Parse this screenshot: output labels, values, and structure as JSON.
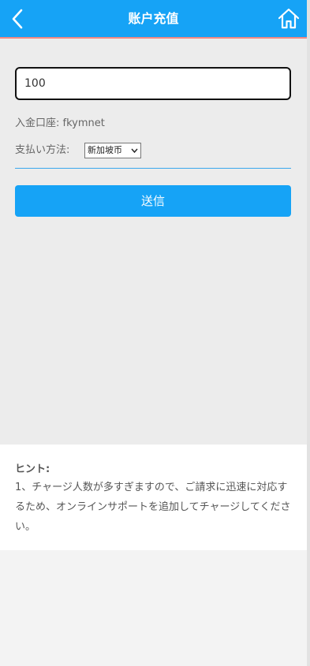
{
  "header": {
    "title": "账户充值",
    "back_icon": "chevron-left-icon",
    "home_icon": "home-icon",
    "accent_color": "#16a3f6"
  },
  "form": {
    "amount_value": "100",
    "account_label": "入金口座:",
    "account_value": "fkymnet",
    "method_label": "支払い方法:",
    "method_selected": "新加坡币",
    "submit_label": "送信"
  },
  "hint": {
    "title": "ヒント:",
    "text": "1、チャージ人数が多すぎますので、ご請求に迅速に対応するため、オンラインサポートを追加してチャージしてください。"
  }
}
